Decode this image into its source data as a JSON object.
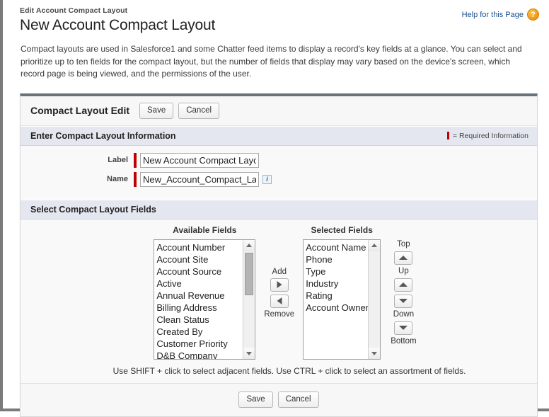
{
  "header": {
    "breadcrumb": "Edit Account Compact Layout",
    "title": "New Account Compact Layout",
    "help_label": "Help for this Page",
    "help_icon": "question-mark-icon",
    "help_icon_glyph": "?",
    "help_link_color": "#1a4d8f",
    "help_icon_color": "#f5a623"
  },
  "intro": "Compact layouts are used in Salesforce1 and some Chatter feed items to display a record's key fields at a glance. You can select and prioritize up to ten fields for the compact layout, but the number of fields that display may vary based on the device's screen, which record page is being viewed, and the permissions of the user.",
  "panel": {
    "title": "Compact Layout Edit",
    "save_label": "Save",
    "cancel_label": "Cancel"
  },
  "info_section": {
    "title": "Enter Compact Layout Information",
    "required_legend": "= Required Information",
    "required_color": "#c00000",
    "fields": {
      "label": {
        "label": "Label",
        "value": "New Account Compact Layout",
        "placeholder": ""
      },
      "name": {
        "label": "Name",
        "value": "New_Account_Compact_Layout",
        "placeholder": "",
        "info_icon": "info-icon",
        "info_glyph": "i"
      }
    }
  },
  "fields_section": {
    "title": "Select Compact Layout Fields",
    "available": {
      "heading": "Available Fields",
      "items": [
        "Account Number",
        "Account Site",
        "Account Source",
        "Active",
        "Annual Revenue",
        "Billing Address",
        "Clean Status",
        "Created By",
        "Customer Priority",
        "D&B Company"
      ]
    },
    "selected": {
      "heading": "Selected Fields",
      "items": [
        "Account Name",
        "Phone",
        "Type",
        "Industry",
        "Rating",
        "Account Owner"
      ]
    },
    "transfer": {
      "add_label": "Add",
      "remove_label": "Remove",
      "add_icon": "arrow-right-icon",
      "remove_icon": "arrow-left-icon"
    },
    "reorder": {
      "top_label": "Top",
      "up_label": "Up",
      "down_label": "Down",
      "bottom_label": "Bottom",
      "top_icon": "move-to-top-icon",
      "up_icon": "arrow-up-icon",
      "down_icon": "arrow-down-icon",
      "bottom_icon": "move-to-bottom-icon"
    },
    "hint": "Use SHIFT + click to select adjacent fields. Use CTRL + click to select an assortment of fields."
  },
  "footer": {
    "save_label": "Save",
    "cancel_label": "Cancel"
  }
}
